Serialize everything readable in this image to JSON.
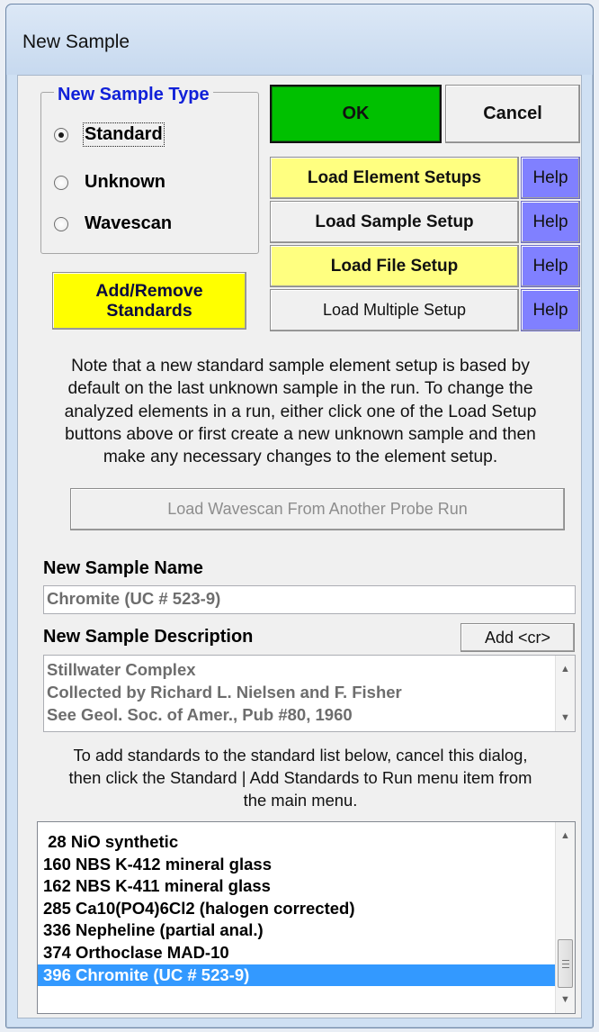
{
  "window": {
    "title": "New Sample"
  },
  "sample_type": {
    "group_label": "New Sample Type",
    "options": [
      "Standard",
      "Unknown",
      "Wavescan"
    ],
    "selected": "Standard"
  },
  "buttons": {
    "ok": "OK",
    "cancel": "Cancel",
    "add_remove_line1": "Add/Remove",
    "add_remove_line2": "Standards",
    "load_element_setups": "Load Element Setups",
    "load_sample_setup": "Load Sample Setup",
    "load_file_setup": "Load File Setup",
    "load_multiple_setup": "Load Multiple Setup",
    "help": "Help",
    "load_wavescan": "Load Wavescan From Another Probe Run",
    "add_cr": "Add <cr>"
  },
  "note": {
    "lines": [
      "Note that a new standard sample element setup is based by",
      "default on the last unknown sample in the run. To change the",
      "analyzed elements in a run, either click one of the Load Setup",
      "buttons above or first create a new unknown sample and then",
      "make any necessary changes to the element setup."
    ]
  },
  "sample_name": {
    "label": "New Sample Name",
    "value": "Chromite (UC # 523-9)"
  },
  "sample_description": {
    "label": "New Sample Description",
    "lines": [
      "Stillwater Complex",
      "Collected by Richard L. Nielsen and F. Fisher",
      "See Geol. Soc. of Amer., Pub #80, 1960"
    ]
  },
  "standards_note": {
    "lines": [
      "To add standards to the standard list below, cancel this dialog,",
      "then click the Standard | Add Standards to Run menu item from",
      "the main menu."
    ]
  },
  "standards_list": {
    "items": [
      " 28 NiO synthetic",
      "160 NBS K-412 mineral glass",
      "162 NBS K-411 mineral glass",
      "285 Ca10(PO4)6Cl2 (halogen corrected)",
      "336 Nepheline (partial anal.)",
      "374 Orthoclase MAD-10",
      "396 Chromite (UC # 523-9)"
    ],
    "selected_index": 6
  },
  "colors": {
    "ok_green": "#00c000",
    "yellow": "#ffff80",
    "add_remove_yellow": "#ffff00",
    "help_blue": "#8080ff",
    "group_label_blue": "#1020d8",
    "selection_blue": "#3399ff"
  }
}
